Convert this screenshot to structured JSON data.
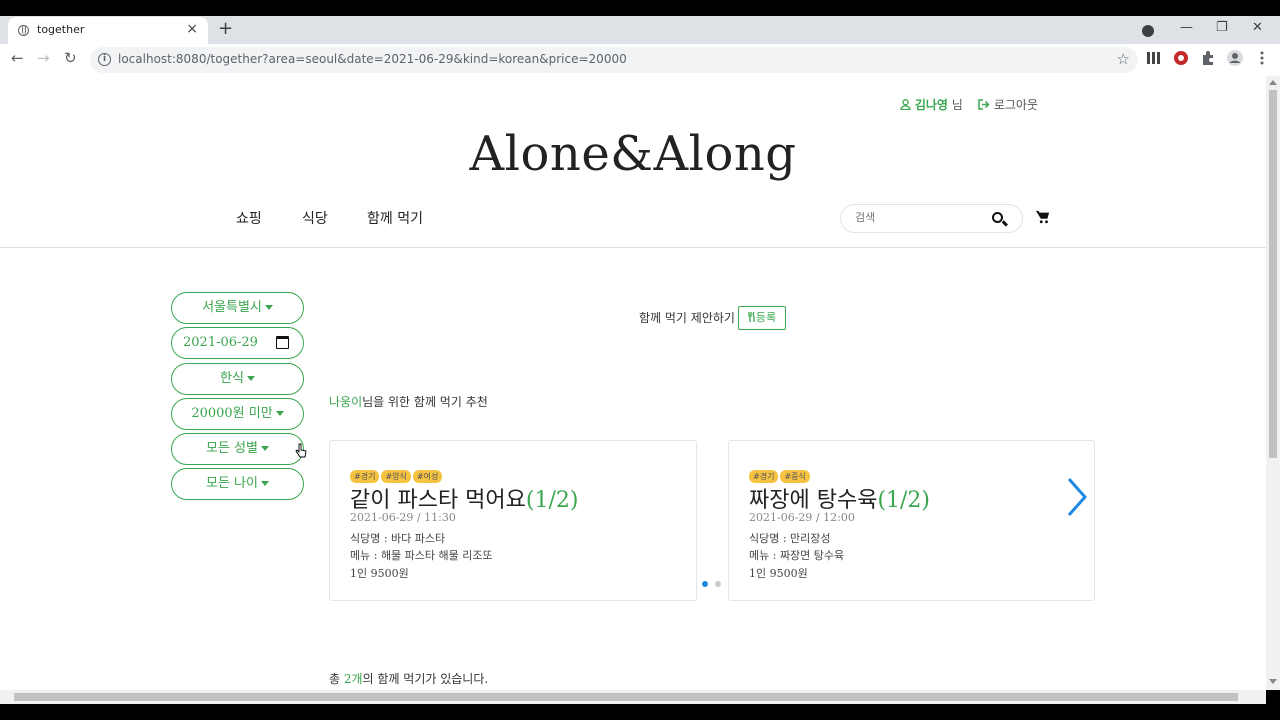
{
  "browser": {
    "tab_title": "together",
    "tab_close": "×",
    "new_tab": "+",
    "url": "localhost:8080/together?area=seoul&date=2021-06-29&kind=korean&price=20000",
    "info_icon": "i",
    "bookmark_star": "☆",
    "minimize": "—",
    "maximize": "❐",
    "close": "✕",
    "back": "←",
    "forward": "→",
    "reload": "↻"
  },
  "header": {
    "user_name": "김나영",
    "user_suffix": " 님",
    "logout_label": "로그아웃",
    "logo": "Alone&Along",
    "nav": [
      "쇼핑",
      "식당",
      "함께 먹기"
    ],
    "search_placeholder": "검색"
  },
  "filters": {
    "area": "서울특별시",
    "date": "2021-06-29",
    "kind": "한식",
    "price": "20000원 미만",
    "gender": "모든 성별",
    "age": "모든 나이"
  },
  "proposal": {
    "text": "함께 먹기 제안하기",
    "register_label": "등록"
  },
  "recommend": {
    "name": "나웅이",
    "suffix": "님을 위한 함께 먹기 추천"
  },
  "cards": [
    {
      "tags": [
        "#경기",
        "#양식",
        "#여성"
      ],
      "title": "같이 파스타 먹어요",
      "count": "(1/2)",
      "datetime": "2021-06-29 / 11:30",
      "restaurant": "식당명 : 바다 파스타",
      "menu": "메뉴 : 해물 파스타 해물 리조또",
      "price": "1인 9500원"
    },
    {
      "tags": [
        "#경기",
        "#중식"
      ],
      "title": "짜장에 탕수육",
      "count": "(1/2)",
      "datetime": "2021-06-29 / 12:00",
      "restaurant": "식당명 : 만리장성",
      "menu": "메뉴 : 짜장면 탕수육",
      "price": "1인 9500원"
    }
  ],
  "carousel": {
    "active_index": 0,
    "total": 2,
    "active_color": "#1e88e5",
    "inactive_color": "#cccccc"
  },
  "total": {
    "prefix": "총 ",
    "count": "2개",
    "suffix": "의 함께 먹기가 있습니다."
  },
  "colors": {
    "accent": "#3aa64f",
    "tag": "#f5c242",
    "arrow": "#1e88e5"
  }
}
